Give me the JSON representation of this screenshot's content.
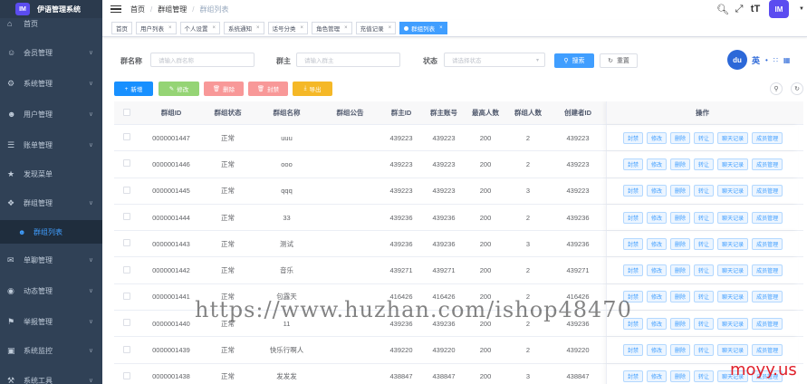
{
  "app": {
    "logo_text": "IM",
    "title": "伊语管理系统"
  },
  "sidebar": {
    "items": [
      {
        "label": "首页",
        "has_children": false
      },
      {
        "label": "会员管理",
        "has_children": true
      },
      {
        "label": "系统管理",
        "has_children": true
      },
      {
        "label": "用户管理",
        "has_children": true
      },
      {
        "label": "账单管理",
        "has_children": true
      },
      {
        "label": "发现菜单",
        "has_children": false
      },
      {
        "label": "群组管理",
        "has_children": true
      },
      {
        "label": "单聊管理",
        "has_children": true
      },
      {
        "label": "动态管理",
        "has_children": true
      },
      {
        "label": "举报管理",
        "has_children": true
      },
      {
        "label": "系统监控",
        "has_children": true
      },
      {
        "label": "系统工具",
        "has_children": true
      }
    ],
    "active_sub": "群组列表"
  },
  "navbar": {
    "breadcrumb": [
      "首页",
      "群组管理",
      "群组列表"
    ],
    "avatar_text": "IM"
  },
  "tags": [
    {
      "label": "首页",
      "closable": false,
      "active": false
    },
    {
      "label": "用户列表",
      "closable": true,
      "active": false
    },
    {
      "label": "个人设置",
      "closable": true,
      "active": false
    },
    {
      "label": "系统通知",
      "closable": true,
      "active": false
    },
    {
      "label": "话号分类",
      "closable": true,
      "active": false
    },
    {
      "label": "角色管理",
      "closable": true,
      "active": false
    },
    {
      "label": "充值记录",
      "closable": true,
      "active": false
    },
    {
      "label": "群组列表",
      "closable": true,
      "active": true
    }
  ],
  "search": {
    "group_name_label": "群名称",
    "group_name_placeholder": "请输入群名称",
    "owner_label": "群主",
    "owner_placeholder": "请输入群主",
    "status_label": "状态",
    "status_placeholder": "请选择状态",
    "search_button": "搜索",
    "reset_button": "重置"
  },
  "ime": {
    "logo": "du",
    "lang": "英"
  },
  "toolbar": {
    "add": "新增",
    "edit": "修改",
    "delete": "删除",
    "ban": "封禁",
    "export": "导出"
  },
  "colors": {
    "sidebar_bg": "#304156",
    "primary": "#409eff",
    "add": "#1890ff",
    "edit": "#95d475",
    "delete": "#f89898",
    "ban": "#f89898",
    "export": "#f5b827"
  },
  "table": {
    "columns": [
      "群组ID",
      "群组状态",
      "群组名称",
      "群组公告",
      "群主ID",
      "群主账号",
      "最高人数",
      "群组人数",
      "创建者ID",
      "操作"
    ],
    "row_actions": [
      "封禁",
      "修改",
      "删除",
      "转让",
      "聊天记录",
      "成员管理"
    ],
    "rows": [
      {
        "id": "0000001447",
        "status": "正常",
        "name": "uuu",
        "notice": "",
        "owner_id": "439223",
        "owner_account": "439223",
        "max": "200",
        "count": "2",
        "creator_id": "439223"
      },
      {
        "id": "0000001446",
        "status": "正常",
        "name": "ooo",
        "notice": "",
        "owner_id": "439223",
        "owner_account": "439223",
        "max": "200",
        "count": "2",
        "creator_id": "439223"
      },
      {
        "id": "0000001445",
        "status": "正常",
        "name": "qqq",
        "notice": "",
        "owner_id": "439223",
        "owner_account": "439223",
        "max": "200",
        "count": "3",
        "creator_id": "439223"
      },
      {
        "id": "0000001444",
        "status": "正常",
        "name": "33",
        "notice": "",
        "owner_id": "439236",
        "owner_account": "439236",
        "max": "200",
        "count": "2",
        "creator_id": "439236"
      },
      {
        "id": "0000001443",
        "status": "正常",
        "name": "测试",
        "notice": "",
        "owner_id": "439236",
        "owner_account": "439236",
        "max": "200",
        "count": "3",
        "creator_id": "439236"
      },
      {
        "id": "0000001442",
        "status": "正常",
        "name": "音乐",
        "notice": "",
        "owner_id": "439271",
        "owner_account": "439271",
        "max": "200",
        "count": "2",
        "creator_id": "439271"
      },
      {
        "id": "0000001441",
        "status": "正常",
        "name": "包露天",
        "notice": "",
        "owner_id": "416426",
        "owner_account": "416426",
        "max": "200",
        "count": "2",
        "creator_id": "416426"
      },
      {
        "id": "0000001440",
        "status": "正常",
        "name": "11",
        "notice": "",
        "owner_id": "439236",
        "owner_account": "439236",
        "max": "200",
        "count": "2",
        "creator_id": "439236"
      },
      {
        "id": "0000001439",
        "status": "正常",
        "name": "快乐行啊人",
        "notice": "",
        "owner_id": "439220",
        "owner_account": "439220",
        "max": "200",
        "count": "2",
        "creator_id": "439220"
      },
      {
        "id": "0000001438",
        "status": "正常",
        "name": "发发发",
        "notice": "",
        "owner_id": "438847",
        "owner_account": "438847",
        "max": "200",
        "count": "3",
        "creator_id": "438847"
      }
    ]
  },
  "watermarks": {
    "url": "https://www.huzhan.com/ishop48470",
    "brand": "moyy.us"
  }
}
